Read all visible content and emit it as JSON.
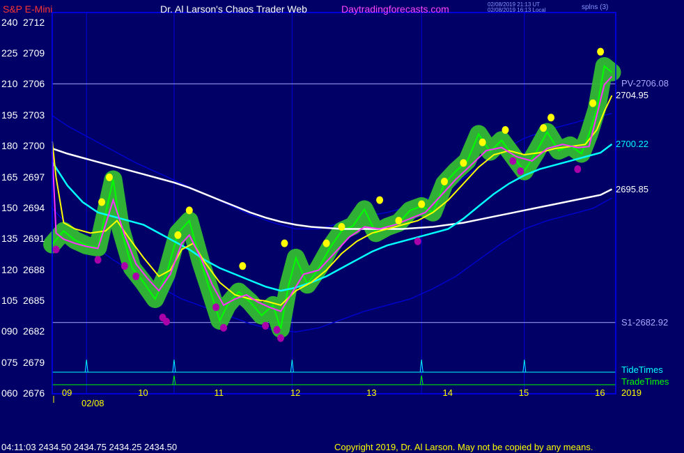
{
  "header": {
    "symbol": "S&P E-Mini",
    "title": "Dr. Al Larson's Chaos Trader Web",
    "site": "Daytradingforecasts.com",
    "timestamp_utc": "02/08/2019 21:13 UT",
    "timestamp_local": "02/08/2019 16:13 Local",
    "corner": "splns (3)"
  },
  "colors": {
    "background": "#000066",
    "frame": "#0000ff",
    "price": "#00ff00",
    "glow": "#33bb33",
    "fast_avg": "#ff33ff",
    "mid_avg": "#ffff00",
    "slow_avg": "#00ffff",
    "long_avg": "#ffffff",
    "band": "#0000cc",
    "high_marker": "#ffff00",
    "low_marker": "#aa00aa",
    "tide": "#00ffff",
    "trade": "#00ff00"
  },
  "chart_data": {
    "type": "line",
    "title": "S&P E-Mini",
    "ylim": [
      2676,
      2713
    ],
    "xlim": [
      8.8,
      16.2
    ],
    "y_ticks": [
      {
        "value": 2712,
        "left": "240",
        "right": "2712"
      },
      {
        "value": 2709,
        "left": "225",
        "right": "2709"
      },
      {
        "value": 2706,
        "left": "210",
        "right": "2706"
      },
      {
        "value": 2703,
        "left": "195",
        "right": "2703"
      },
      {
        "value": 2700,
        "left": "180",
        "right": "2700"
      },
      {
        "value": 2697,
        "left": "165",
        "right": "2697"
      },
      {
        "value": 2694,
        "left": "150",
        "right": "2694"
      },
      {
        "value": 2691,
        "left": "135",
        "right": "2691"
      },
      {
        "value": 2688,
        "left": "120",
        "right": "2688"
      },
      {
        "value": 2685,
        "left": "105",
        "right": "2685"
      },
      {
        "value": 2682,
        "left": "090",
        "right": "2682"
      },
      {
        "value": 2679,
        "left": "075",
        "right": "2679"
      },
      {
        "value": 2676,
        "left": "060",
        "right": "2676"
      }
    ],
    "x_ticks": [
      {
        "value": 9,
        "label": "09"
      },
      {
        "value": 10,
        "label": "10"
      },
      {
        "value": 11,
        "label": "11"
      },
      {
        "value": 12,
        "label": "12"
      },
      {
        "value": 13,
        "label": "13"
      },
      {
        "value": 14,
        "label": "14"
      },
      {
        "value": 15,
        "label": "15"
      },
      {
        "value": 16,
        "label": "16"
      }
    ],
    "date_label": "02/08",
    "year_label": "2019",
    "vertical_lines": [
      9.25,
      10.4,
      11.95,
      13.65,
      15.0
    ],
    "levels": [
      {
        "name": "PV",
        "label": "PV-2706.08",
        "value": 2706.08,
        "color": "#aaaaff"
      },
      {
        "name": "S1",
        "label": "S1-2682.92",
        "value": 2682.92,
        "color": "#aaaaff"
      }
    ],
    "end_labels": [
      {
        "label": "2704.95",
        "value": 2704.95,
        "color": "#ffffff"
      },
      {
        "label": "2700.22",
        "value": 2700.22,
        "color": "#00ffff"
      },
      {
        "label": "2695.85",
        "value": 2695.85,
        "color": "#ffffff"
      }
    ],
    "series": [
      {
        "name": "price",
        "color": "#00ff00",
        "x": [
          8.8,
          8.95,
          9.1,
          9.25,
          9.4,
          9.5,
          9.6,
          9.7,
          9.85,
          10.0,
          10.15,
          10.3,
          10.45,
          10.6,
          10.75,
          10.9,
          11.0,
          11.1,
          11.25,
          11.4,
          11.55,
          11.7,
          11.8,
          11.9,
          12.0,
          12.15,
          12.3,
          12.45,
          12.6,
          12.75,
          12.9,
          13.05,
          13.2,
          13.35,
          13.5,
          13.65,
          13.8,
          13.95,
          14.1,
          14.25,
          14.4,
          14.55,
          14.7,
          14.85,
          15.0,
          15.15,
          15.3,
          15.45,
          15.6,
          15.75,
          15.85,
          15.95,
          16.05,
          16.15
        ],
        "y": [
          2690.5,
          2691.8,
          2690.9,
          2690.4,
          2690.2,
          2693.5,
          2696.8,
          2692.0,
          2688.2,
          2686.8,
          2685.2,
          2687.6,
          2691.6,
          2692.8,
          2688.8,
          2685.4,
          2683.1,
          2684.6,
          2685.9,
          2684.9,
          2683.6,
          2684.6,
          2682.3,
          2686.4,
          2689.2,
          2686.6,
          2688.2,
          2690.2,
          2691.8,
          2692.3,
          2693.9,
          2691.6,
          2692.2,
          2692.6,
          2693.8,
          2694.2,
          2693.6,
          2696.4,
          2697.6,
          2698.6,
          2701.2,
          2699.5,
          2700.6,
          2699.1,
          2697.6,
          2699.4,
          2701.4,
          2699.6,
          2700.1,
          2699.3,
          2701.2,
          2703.6,
          2707.8,
          2707.2
        ]
      },
      {
        "name": "fast average",
        "color": "#ff33ff",
        "x": [
          8.8,
          8.85,
          8.95,
          9.1,
          9.25,
          9.4,
          9.5,
          9.6,
          9.75,
          9.9,
          10.05,
          10.2,
          10.35,
          10.5,
          10.6,
          10.75,
          10.9,
          11.05,
          11.2,
          11.35,
          11.5,
          11.65,
          11.8,
          11.95,
          12.1,
          12.3,
          12.5,
          12.7,
          12.9,
          13.1,
          13.3,
          13.5,
          13.7,
          13.9,
          14.1,
          14.3,
          14.5,
          14.7,
          14.9,
          15.1,
          15.3,
          15.5,
          15.7,
          15.85,
          15.95,
          16.05,
          16.15
        ],
        "y": [
          2699.5,
          2691.6,
          2691.0,
          2690.6,
          2690.3,
          2690.1,
          2692.4,
          2694.8,
          2691.4,
          2688.6,
          2687.2,
          2686.0,
          2687.6,
          2690.6,
          2691.4,
          2689.2,
          2686.6,
          2684.6,
          2685.2,
          2685.6,
          2684.9,
          2684.4,
          2684.0,
          2685.8,
          2687.6,
          2688.0,
          2689.6,
          2691.2,
          2692.2,
          2692.0,
          2692.4,
          2693.0,
          2693.6,
          2695.2,
          2696.8,
          2698.2,
          2699.6,
          2699.9,
          2699.0,
          2698.6,
          2699.8,
          2700.2,
          2699.9,
          2700.0,
          2703.0,
          2706.0,
          2706.8
        ]
      },
      {
        "name": "mid average",
        "color": "#ffff00",
        "x": [
          8.8,
          8.85,
          8.95,
          9.1,
          9.3,
          9.5,
          9.65,
          9.8,
          10.0,
          10.2,
          10.35,
          10.5,
          10.65,
          10.8,
          11.0,
          11.2,
          11.4,
          11.6,
          11.8,
          12.0,
          12.2,
          12.4,
          12.6,
          12.8,
          13.0,
          13.2,
          13.4,
          13.6,
          13.8,
          14.0,
          14.2,
          14.4,
          14.6,
          14.8,
          15.0,
          15.2,
          15.4,
          15.6,
          15.8,
          15.95,
          16.05,
          16.15
        ],
        "y": [
          2700.5,
          2697.0,
          2692.6,
          2692.0,
          2691.6,
          2691.8,
          2692.8,
          2691.2,
          2689.2,
          2687.4,
          2688.0,
          2690.0,
          2690.6,
          2688.8,
          2686.8,
          2685.6,
          2685.2,
          2685.0,
          2684.6,
          2686.0,
          2686.8,
          2688.0,
          2689.6,
          2690.8,
          2691.6,
          2692.0,
          2692.4,
          2692.8,
          2693.6,
          2694.8,
          2696.4,
          2698.0,
          2699.2,
          2699.6,
          2699.2,
          2699.4,
          2699.8,
          2700.0,
          2700.2,
          2701.6,
          2703.4,
          2704.95
        ]
      },
      {
        "name": "slow average",
        "color": "#00ffff",
        "x": [
          8.8,
          9.0,
          9.2,
          9.4,
          9.6,
          9.8,
          10.0,
          10.2,
          10.4,
          10.6,
          10.8,
          11.0,
          11.2,
          11.4,
          11.6,
          11.8,
          12.0,
          12.2,
          12.4,
          12.6,
          12.8,
          13.0,
          13.2,
          13.4,
          13.6,
          13.8,
          14.0,
          14.2,
          14.4,
          14.6,
          14.8,
          15.0,
          15.2,
          15.4,
          15.6,
          15.8,
          16.0,
          16.15
        ],
        "y": [
          2698.5,
          2696.2,
          2694.6,
          2693.6,
          2693.2,
          2692.8,
          2692.4,
          2691.6,
          2690.8,
          2690.0,
          2689.0,
          2688.2,
          2687.6,
          2687.0,
          2686.4,
          2686.0,
          2686.3,
          2686.8,
          2687.4,
          2688.2,
          2689.0,
          2689.8,
          2690.4,
          2690.8,
          2691.2,
          2691.6,
          2692.0,
          2693.0,
          2694.2,
          2695.4,
          2696.4,
          2697.2,
          2697.8,
          2698.2,
          2698.6,
          2699.0,
          2699.4,
          2700.22
        ]
      },
      {
        "name": "long average",
        "color": "#ffffff",
        "x": [
          8.8,
          9.0,
          9.2,
          9.4,
          9.6,
          9.8,
          10.0,
          10.2,
          10.4,
          10.6,
          10.8,
          11.0,
          11.2,
          11.4,
          11.6,
          11.8,
          12.0,
          12.2,
          12.4,
          12.6,
          12.8,
          13.0,
          13.2,
          13.4,
          13.6,
          13.8,
          14.0,
          14.2,
          14.4,
          14.6,
          14.8,
          15.0,
          15.2,
          15.4,
          15.6,
          15.8,
          16.0,
          16.15
        ],
        "y": [
          2699.8,
          2699.3,
          2698.9,
          2698.5,
          2698.1,
          2697.7,
          2697.3,
          2696.9,
          2696.5,
          2696.0,
          2695.4,
          2694.8,
          2694.2,
          2693.6,
          2693.1,
          2692.7,
          2692.4,
          2692.2,
          2692.1,
          2692.0,
          2692.0,
          2692.0,
          2692.0,
          2692.0,
          2692.1,
          2692.2,
          2692.4,
          2692.6,
          2692.9,
          2693.2,
          2693.5,
          2693.8,
          2694.1,
          2694.4,
          2694.7,
          2695.0,
          2695.3,
          2695.85
        ]
      },
      {
        "name": "upper band",
        "color": "#0000cc",
        "x": [
          8.8,
          9.0,
          9.3,
          9.6,
          9.9,
          10.2,
          10.5,
          10.8,
          11.1,
          11.4,
          11.7,
          12.0,
          12.3,
          12.6,
          12.9,
          13.2,
          13.5,
          13.8,
          14.1,
          14.4,
          14.7,
          15.0,
          15.3,
          15.6,
          15.9,
          16.15
        ],
        "y": [
          2703.0,
          2702.0,
          2700.8,
          2699.6,
          2698.4,
          2697.4,
          2696.4,
          2695.4,
          2694.4,
          2693.4,
          2692.6,
          2692.0,
          2692.0,
          2692.6,
          2693.2,
          2693.6,
          2694.2,
          2695.2,
          2696.4,
          2698.0,
          2699.6,
          2700.8,
          2701.6,
          2702.2,
          2702.8,
          2703.2
        ]
      },
      {
        "name": "lower band",
        "color": "#0000cc",
        "x": [
          8.8,
          9.0,
          9.3,
          9.6,
          9.9,
          10.2,
          10.5,
          10.8,
          11.1,
          11.4,
          11.7,
          12.0,
          12.3,
          12.6,
          12.9,
          13.2,
          13.5,
          13.8,
          14.1,
          14.4,
          14.7,
          15.0,
          15.3,
          15.6,
          15.9,
          16.15
        ],
        "y": [
          2694.0,
          2692.4,
          2690.6,
          2689.0,
          2687.6,
          2686.4,
          2685.2,
          2684.4,
          2683.6,
          2682.8,
          2682.2,
          2682.0,
          2682.4,
          2683.2,
          2684.0,
          2684.6,
          2685.2,
          2686.2,
          2687.4,
          2689.0,
          2690.6,
          2692.0,
          2692.8,
          2693.4,
          2694.0,
          2695.0
        ]
      },
      {
        "name": "TideTimes",
        "color": "#00ffff",
        "x": [
          9.25,
          10.4,
          11.95,
          13.65,
          15.0
        ]
      },
      {
        "name": "TradeTimes",
        "color": "#00ff00",
        "x": [
          10.4,
          13.65
        ]
      }
    ],
    "highs": {
      "x": [
        9.45,
        9.55,
        10.45,
        10.6,
        11.3,
        11.85,
        12.4,
        12.6,
        13.1,
        13.35,
        13.65,
        13.95,
        14.2,
        14.45,
        14.75,
        15.25,
        15.35,
        15.9,
        16.0
      ],
      "y": [
        2694.6,
        2697.0,
        2691.4,
        2693.8,
        2688.4,
        2690.6,
        2690.6,
        2692.2,
        2694.8,
        2692.8,
        2694.4,
        2696.6,
        2698.4,
        2700.4,
        2701.6,
        2701.8,
        2702.8,
        2704.2,
        2709.2
      ]
    },
    "lows": {
      "x": [
        8.85,
        9.4,
        9.75,
        9.9,
        10.25,
        10.3,
        10.95,
        11.05,
        11.6,
        11.75,
        11.8,
        13.6,
        14.85,
        14.95,
        15.7
      ],
      "y": [
        2690.0,
        2689.0,
        2688.4,
        2687.4,
        2683.4,
        2683.0,
        2684.4,
        2682.4,
        2682.6,
        2682.2,
        2681.4,
        2690.8,
        2698.6,
        2697.6,
        2697.8
      ]
    }
  },
  "legend": {
    "tide": "TideTimes",
    "trade": "TradeTimes"
  },
  "footer": {
    "quote": "04:11:03  2434.50  2434.75  2434.25  2434.50",
    "copyright": "Copyright 2019, Dr. Al Larson. May not be copied by any means."
  }
}
